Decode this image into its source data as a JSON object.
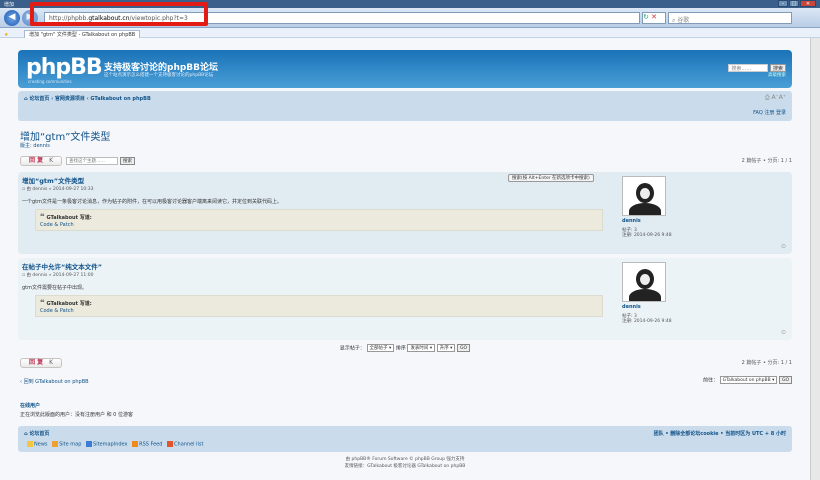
{
  "browser": {
    "title": "增加",
    "url_prefix": "http://phpbb.",
    "url_domain": "gtalkabout.cn",
    "url_path": "/viewtopic.php?t=3",
    "search_placeholder": "谷歌",
    "fav_tab": "增加 \"gtm\" 文件类型 - GTalkabout on phpBB"
  },
  "banner": {
    "logo": "phpBB",
    "logo_sub": "creating communities",
    "site_title": "支持极客讨论的phpBB论坛",
    "site_desc": "这个站点演示怎么搭建一个支持极客讨论的phpBB论坛",
    "search_placeholder": "搜索……",
    "search_button": "搜索",
    "advanced_search": "高级搜索"
  },
  "nav": {
    "breadcrumb": "论坛首页 ‹ 官网资源项目 ‹ GTalkabout on phpBB",
    "user_links": "FAQ  注册  登录"
  },
  "topic": {
    "title": "增加“gtm”文件类型",
    "moderator": "版主: dennis",
    "reply_label": "回 复",
    "reply_icon": "K",
    "search_placeholder": "查找这个主题……",
    "search_button": "搜索",
    "pagination": "2 篇帖子 • 分页: 1 / 1",
    "pagination_bottom": "2 篇帖子 • 分页: 1 / 1"
  },
  "posts": [
    {
      "title": "增加“gtm”文件类型",
      "meta": "由 dennis » 2014-09-27 10:33",
      "body": "一个gtm文件是一条极客讨论消息，作为帖子的附件，在可以用极客讨论器客户端离来阅读它，并定位到关联代码上。",
      "quote_author": "GTalkabout 写道",
      "quote_body": "Code & Patch",
      "inline_button": "搜索(按 Alt+Enter 在新选项卡中搜索)",
      "author": "dennis",
      "posts": "帖子: 3",
      "joined": "注册: 2014-09-26 9:48"
    },
    {
      "title": "在帖子中允许“纯文本文件”",
      "meta": "由 dennis » 2014-09-27 11:00",
      "body": "gtm文件需要在帖子中出现。",
      "quote_author": "GTalkabout 写道",
      "quote_body": "Code & Patch",
      "author": "dennis",
      "posts": "帖子: 3",
      "joined": "注册: 2014-09-26 9:48"
    }
  ],
  "sort": {
    "label": "显示帖子：",
    "all_posts": "全部帖子",
    "sort_label": "排序",
    "sort_field": "发表时间",
    "order": "升序",
    "go": "GO"
  },
  "footer": {
    "return_link": "‹ 回到 GTalkabout on phpBB",
    "jump_label": "前往：",
    "jump_value": "GTalkabout on phpBB",
    "jump_go": "GO",
    "online_heading": "在线用户",
    "online_text": "正在浏览此版面的用户：没有注册用户 和 0 位游客",
    "home": "论坛首页",
    "right_links": "团队 • 删除全部论坛cookie • 当前时区为 UTC + 8 小时",
    "links": [
      "News",
      "Site map",
      "SitemapIndex",
      "RSS Feed",
      "Channel list"
    ],
    "copyright1": "由 phpBB® Forum Software © phpBB Group 强力支持",
    "copyright2": "友情链接：GTalkabout 极客讨论器 GTalkabout on phpBB"
  }
}
